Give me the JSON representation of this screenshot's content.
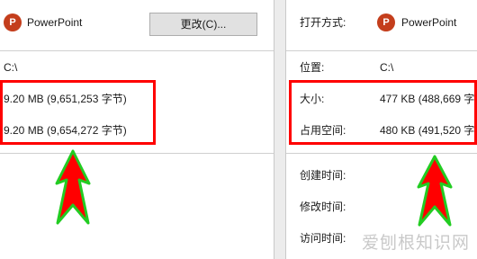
{
  "left_panel": {
    "app_name": "PowerPoint",
    "change_button": "更改(C)...",
    "location_value": "C:\\",
    "size_value": "9.20 MB (9,651,253 字节)",
    "size_on_disk_value": "9.20 MB (9,654,272 字节)"
  },
  "right_panel": {
    "open_with_label": "打开方式:",
    "app_name": "PowerPoint",
    "location_label": "位置:",
    "location_value": "C:\\",
    "size_label": "大小:",
    "size_value": "477 KB (488,669 字",
    "size_on_disk_label": "占用空间:",
    "size_on_disk_value": "480 KB (491,520 字",
    "created_label": "创建时间:",
    "modified_label": "修改时间:",
    "accessed_label": "访问时间:"
  },
  "icons": {
    "app_icon": "powerpoint-icon",
    "annotation": "up-arrow-icon"
  },
  "colors": {
    "highlight": "#ff0000",
    "arrow_fill": "#ff0000",
    "arrow_outline": "#22cc22",
    "ppt": "#c43e1c"
  },
  "watermark": "爱刨根知识网"
}
